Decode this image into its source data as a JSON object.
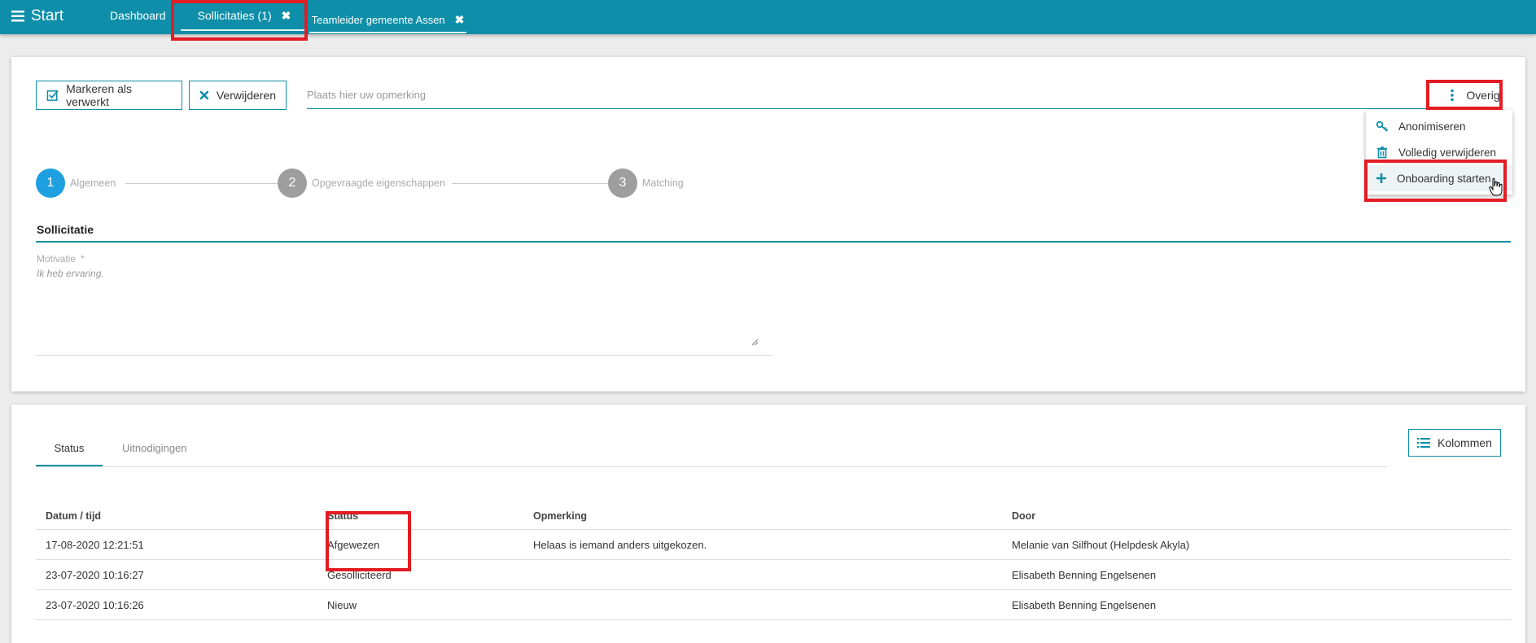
{
  "topbar": {
    "menu_label": "Start",
    "tabs": [
      {
        "label": "Dashboard"
      },
      {
        "label": "Sollicitaties (1)",
        "close": "✖"
      },
      {
        "label": "Teamleider gemeente Assen",
        "close": "✖"
      }
    ]
  },
  "toolbar": {
    "mark_label": "Markeren als verwerkt",
    "delete_label": "Verwijderen",
    "remark_placeholder": "Plaats hier uw opmerking",
    "overig_label": "Overig"
  },
  "overig_menu": {
    "items": [
      {
        "label": "Anonimiseren",
        "icon": "key-icon"
      },
      {
        "label": "Volledig verwijderen",
        "icon": "trash-icon"
      },
      {
        "label": "Onboarding starten",
        "icon": "plus-icon"
      }
    ]
  },
  "stepper": {
    "steps": [
      {
        "number": "1",
        "label": "Algemeen"
      },
      {
        "number": "2",
        "label": "Opgevraagde eigenschappen"
      },
      {
        "number": "3",
        "label": "Matching"
      }
    ]
  },
  "form": {
    "section_title": "Sollicitatie",
    "motivatie_label": "Motivatie",
    "required_mark": "*",
    "motivatie_value": "Ik heb ervaring."
  },
  "history": {
    "tabs": [
      {
        "label": "Status"
      },
      {
        "label": "Uitnodigingen"
      }
    ],
    "kolommen_label": "Kolommen",
    "columns": [
      "Datum / tijd",
      "Status",
      "Opmerking",
      "Door"
    ],
    "rows": [
      [
        "17-08-2020 12:21:51",
        "Afgewezen",
        "Helaas is iemand anders uitgekozen.",
        "Melanie van Silfhout (Helpdesk Akyla)"
      ],
      [
        "23-07-2020 10:16:27",
        "Gesolliciteerd",
        "",
        "Elisabeth Benning Engelsenen"
      ],
      [
        "23-07-2020 10:16:26",
        "Nieuw",
        "",
        "Elisabeth Benning Engelsenen"
      ]
    ]
  },
  "colors": {
    "accent": "#0e8ea8",
    "step_active": "#1ea0e0",
    "highlight": "#e31b23"
  }
}
